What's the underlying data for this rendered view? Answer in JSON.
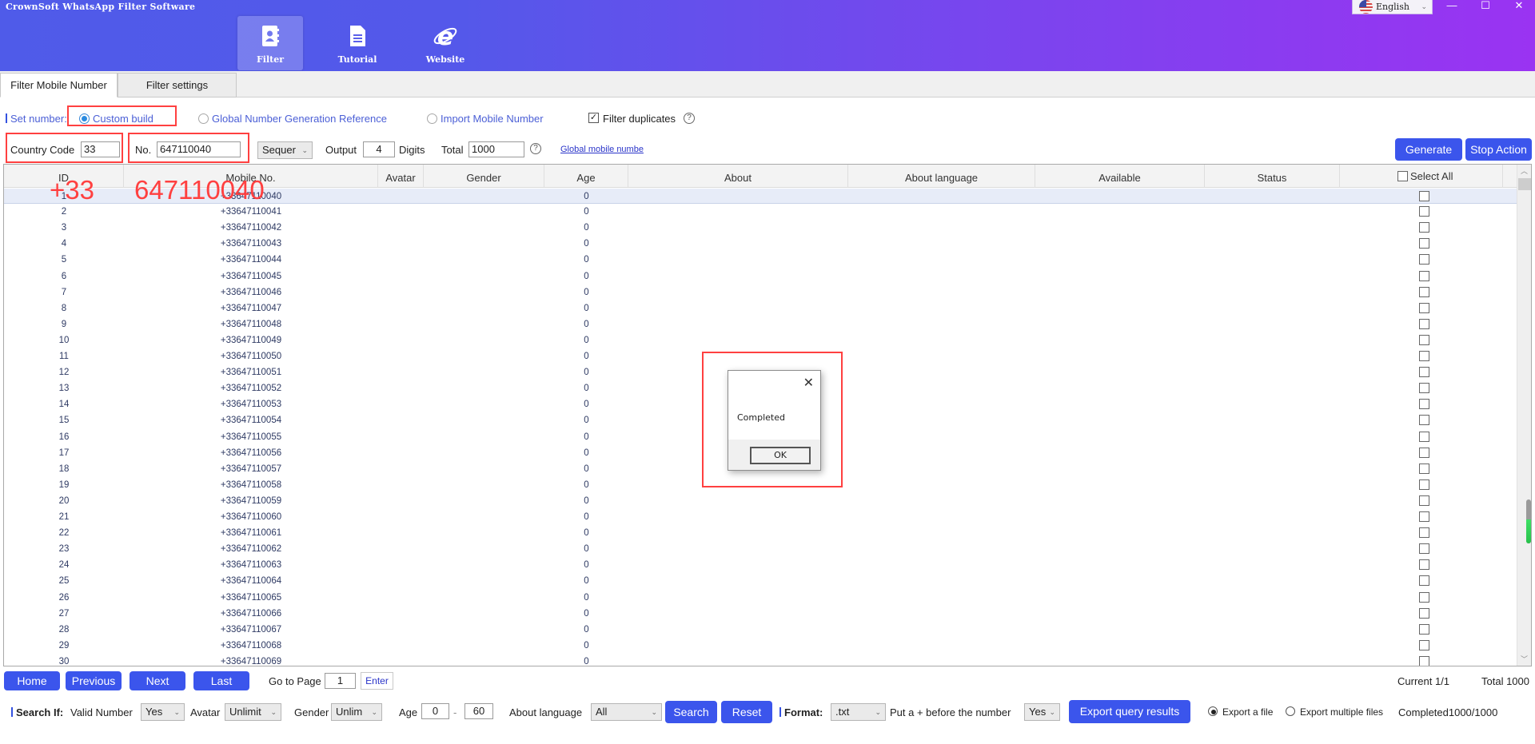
{
  "app": {
    "title": "CrownSoft WhatsApp Filter Software",
    "language": "English",
    "window_controls": {
      "minimize": "—",
      "maximize": "☐",
      "close": "✕"
    }
  },
  "nav": [
    {
      "label": "Filter",
      "icon": "contact-book-icon",
      "active": true
    },
    {
      "label": "Tutorial",
      "icon": "document-icon",
      "active": false
    },
    {
      "label": "Website",
      "icon": "internet-explorer-icon",
      "active": false
    }
  ],
  "tabs": [
    {
      "label": "Filter Mobile Number",
      "active": true
    },
    {
      "label": "Filter settings",
      "active": false
    }
  ],
  "settings": {
    "set_number_label": "Set number:",
    "radio_custom_build": "Custom build",
    "radio_global_ref": "Global Number Generation Reference",
    "radio_import": "Import Mobile Number",
    "selected_mode": "Custom build",
    "filter_duplicates_label": "Filter duplicates",
    "filter_duplicates_checked": true,
    "country_code_label": "Country Code",
    "country_code_value": "33",
    "number_label": "No.",
    "number_value": "647110040",
    "mode_select": "Sequer",
    "output_label": "Output",
    "output_value": "4",
    "digits_label": "Digits",
    "total_label": "Total",
    "total_value": "1000",
    "help_glyph": "?",
    "global_link": "Global mobile numbe",
    "generate_button": "Generate",
    "stop_button": "Stop Action"
  },
  "annotations": {
    "country_code_overlay": "+33",
    "number_overlay": "647110040"
  },
  "table": {
    "columns": [
      "ID",
      "Mobile No.",
      "Avatar",
      "Gender",
      "Age",
      "About",
      "About language",
      "Available",
      "Status"
    ],
    "select_all_label": "Select All",
    "rows": [
      {
        "id": "1",
        "mobile": "+33647110040",
        "age": "0"
      },
      {
        "id": "2",
        "mobile": "+33647110041",
        "age": "0"
      },
      {
        "id": "3",
        "mobile": "+33647110042",
        "age": "0"
      },
      {
        "id": "4",
        "mobile": "+33647110043",
        "age": "0"
      },
      {
        "id": "5",
        "mobile": "+33647110044",
        "age": "0"
      },
      {
        "id": "6",
        "mobile": "+33647110045",
        "age": "0"
      },
      {
        "id": "7",
        "mobile": "+33647110046",
        "age": "0"
      },
      {
        "id": "8",
        "mobile": "+33647110047",
        "age": "0"
      },
      {
        "id": "9",
        "mobile": "+33647110048",
        "age": "0"
      },
      {
        "id": "10",
        "mobile": "+33647110049",
        "age": "0"
      },
      {
        "id": "11",
        "mobile": "+33647110050",
        "age": "0"
      },
      {
        "id": "12",
        "mobile": "+33647110051",
        "age": "0"
      },
      {
        "id": "13",
        "mobile": "+33647110052",
        "age": "0"
      },
      {
        "id": "14",
        "mobile": "+33647110053",
        "age": "0"
      },
      {
        "id": "15",
        "mobile": "+33647110054",
        "age": "0"
      },
      {
        "id": "16",
        "mobile": "+33647110055",
        "age": "0"
      },
      {
        "id": "17",
        "mobile": "+33647110056",
        "age": "0"
      },
      {
        "id": "18",
        "mobile": "+33647110057",
        "age": "0"
      },
      {
        "id": "19",
        "mobile": "+33647110058",
        "age": "0"
      },
      {
        "id": "20",
        "mobile": "+33647110059",
        "age": "0"
      },
      {
        "id": "21",
        "mobile": "+33647110060",
        "age": "0"
      },
      {
        "id": "22",
        "mobile": "+33647110061",
        "age": "0"
      },
      {
        "id": "23",
        "mobile": "+33647110062",
        "age": "0"
      },
      {
        "id": "24",
        "mobile": "+33647110063",
        "age": "0"
      },
      {
        "id": "25",
        "mobile": "+33647110064",
        "age": "0"
      },
      {
        "id": "26",
        "mobile": "+33647110065",
        "age": "0"
      },
      {
        "id": "27",
        "mobile": "+33647110066",
        "age": "0"
      },
      {
        "id": "28",
        "mobile": "+33647110067",
        "age": "0"
      },
      {
        "id": "29",
        "mobile": "+33647110068",
        "age": "0"
      },
      {
        "id": "30",
        "mobile": "+33647110069",
        "age": "0"
      }
    ],
    "selected_row": 0,
    "side_progress_fraction": 0.55
  },
  "pagination": {
    "home": "Home",
    "previous": "Previous",
    "next": "Next",
    "last": "Last",
    "goto_label": "Go to Page",
    "goto_value": "1",
    "enter": "Enter",
    "current": "Current 1/1",
    "total": "Total 1000"
  },
  "search": {
    "label": "Search If:",
    "valid_number_label": "Valid Number",
    "valid_number_value": "Yes",
    "avatar_label": "Avatar",
    "avatar_value": "Unlimit",
    "gender_label": "Gender",
    "gender_value": "Unlim",
    "age_label": "Age",
    "age_min": "0",
    "age_sep": "-",
    "age_max": "60",
    "about_language_label": "About language",
    "about_language_value": "All",
    "search_button": "Search",
    "reset_button": "Reset"
  },
  "export": {
    "format_label": "Format:",
    "format_value": ".txt",
    "plus_label": "Put a + before the number",
    "plus_value": "Yes",
    "export_button": "Export query results",
    "export_single": "Export a file",
    "export_multiple": "Export multiple files",
    "selected_export": "Export a file",
    "status": "Completed1000/1000"
  },
  "dialog": {
    "message": "Completed",
    "ok": "OK",
    "close": "✕"
  },
  "colors": {
    "primary_button": "#3b55ec",
    "header_start": "#4f5be9",
    "header_end": "#9a33f2",
    "annotation": "#ff4040"
  }
}
